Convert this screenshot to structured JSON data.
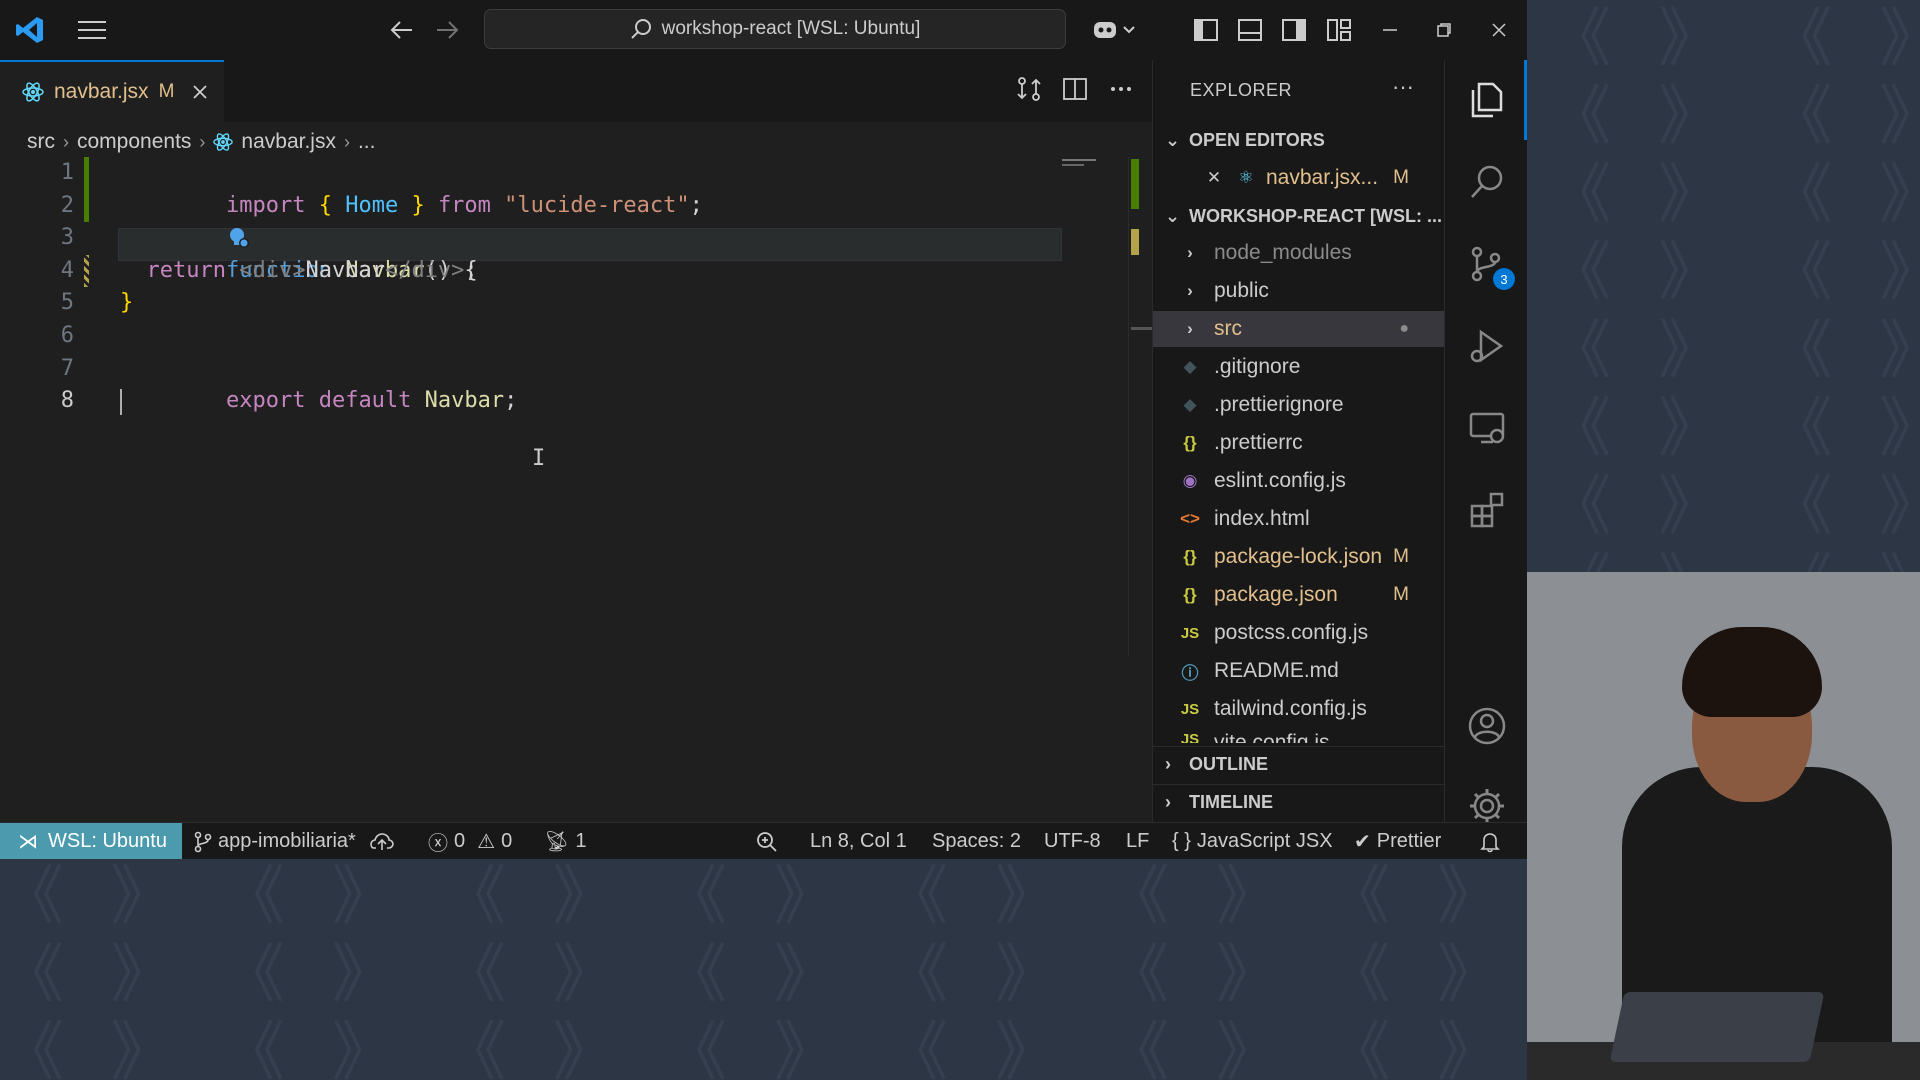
{
  "titlebar": {
    "search_text": "workshop-react [WSL: Ubuntu]"
  },
  "tab": {
    "filename": "navbar.jsx",
    "modified_flag": "M"
  },
  "breadcrumb": {
    "items": [
      "src",
      "components",
      "navbar.jsx",
      "..."
    ]
  },
  "editor": {
    "line_numbers": [
      "1",
      "2",
      "3",
      "4",
      "5",
      "6",
      "7",
      "8"
    ],
    "active_line": "8",
    "code": {
      "l1_import": "import",
      "l1_open": "{",
      "l1_name": "Home",
      "l1_close": "}",
      "l1_from": "from",
      "l1_module": "\"lucide-react\"",
      "l1_semi": ";",
      "l3_function": "function",
      "l3_name": "Navbar",
      "l3_rest": "() {",
      "l4_return": "return",
      "l4_open_tag": "<div>",
      "l4_text": "Navbar",
      "l4_close_tag": "</div>",
      "l4_semi": ";",
      "l5_brace": "}",
      "l7_export": "export",
      "l7_default": "default",
      "l7_name": "Navbar",
      "l7_semi": ";"
    }
  },
  "sidebar": {
    "title": "EXPLORER",
    "more": "···",
    "open_editors_label": "OPEN EDITORS",
    "open_editor_file": "navbar.jsx...",
    "open_editor_flag": "M",
    "workspace_label": "WORKSHOP-REACT [WSL: ...",
    "outline_label": "OUTLINE",
    "timeline_label": "TIMELINE",
    "files": [
      {
        "name": "node_modules",
        "icon": ">",
        "badge": ""
      },
      {
        "name": "public",
        "icon": ">",
        "badge": ""
      },
      {
        "name": "src",
        "icon": ">",
        "badge": "●"
      },
      {
        "name": ".gitignore",
        "icon": "◆",
        "badge": ""
      },
      {
        "name": ".prettierignore",
        "icon": "◆",
        "badge": ""
      },
      {
        "name": ".prettierrc",
        "icon": "{}",
        "badge": ""
      },
      {
        "name": "eslint.config.js",
        "icon": "◉",
        "badge": ""
      },
      {
        "name": "index.html",
        "icon": "<>",
        "badge": ""
      },
      {
        "name": "package-lock.json",
        "icon": "{}",
        "badge": "M"
      },
      {
        "name": "package.json",
        "icon": "{}",
        "badge": "M"
      },
      {
        "name": "postcss.config.js",
        "icon": "JS",
        "badge": ""
      },
      {
        "name": "README.md",
        "icon": "ⓘ",
        "badge": ""
      },
      {
        "name": "tailwind.config.js",
        "icon": "JS",
        "badge": ""
      },
      {
        "name": "vite.config.js",
        "icon": "JS",
        "badge": ""
      }
    ]
  },
  "activity": {
    "scm_badge": "3"
  },
  "statusbar": {
    "remote": "WSL: Ubuntu",
    "branch": "app-imobiliaria*",
    "errors": "0",
    "warnings": "0",
    "ports": "1",
    "position": "Ln 8, Col 1",
    "spaces": "Spaces: 2",
    "encoding": "UTF-8",
    "eol": "LF",
    "language": "JavaScript JSX",
    "formatter": "Prettier"
  },
  "colors": {
    "accent": "#0078d4",
    "modified": "#e2c08d",
    "remote_bg": "#4b9aad"
  }
}
